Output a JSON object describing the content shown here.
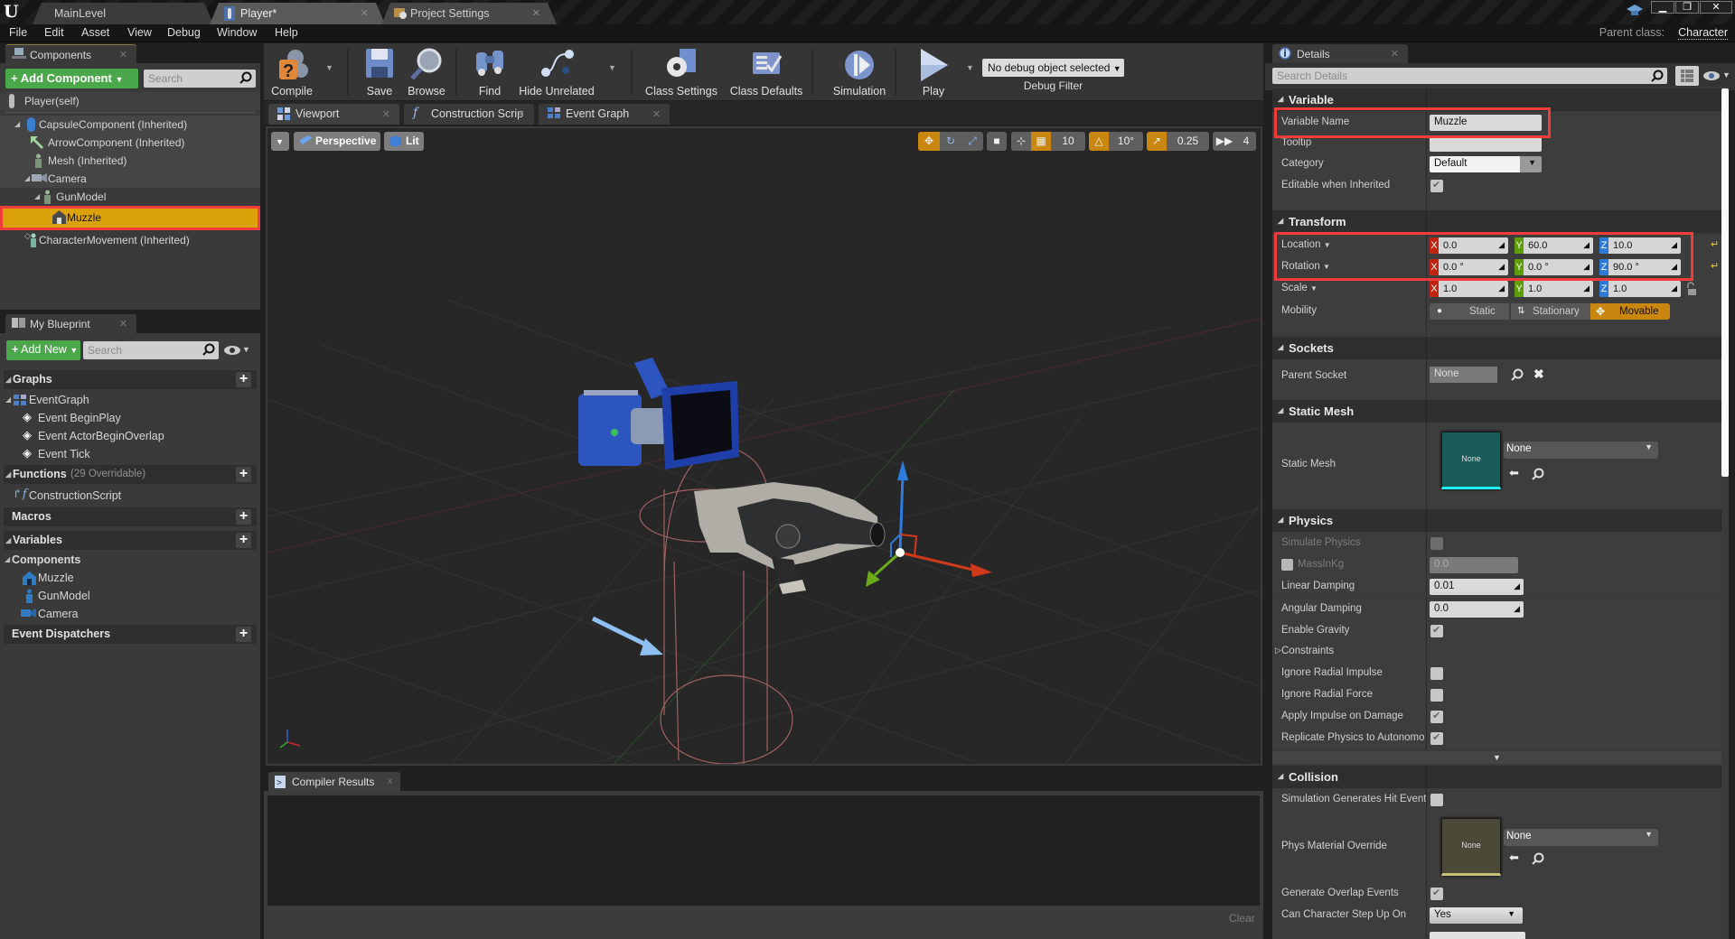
{
  "window": {
    "tabs": [
      {
        "label": "MainLevel"
      },
      {
        "label": "Player*"
      },
      {
        "label": "Project Settings"
      }
    ],
    "parent_class_label": "Parent class:",
    "parent_class_value": "Character"
  },
  "menu": [
    "File",
    "Edit",
    "Asset",
    "View",
    "Debug",
    "Window",
    "Help"
  ],
  "components": {
    "tab_label": "Components",
    "add_button": "Add Component",
    "search_placeholder": "Search",
    "root": "Player(self)",
    "tree": [
      {
        "label": "CapsuleComponent (Inherited)",
        "icon": "capsule-icon"
      },
      {
        "label": "ArrowComponent (Inherited)",
        "icon": "arrow-component-icon"
      },
      {
        "label": "Mesh (Inherited)",
        "icon": "skeletal-mesh-icon"
      },
      {
        "label": "Camera",
        "icon": "camera-icon"
      },
      {
        "label": "GunModel",
        "icon": "skeletal-mesh-icon"
      },
      {
        "label": "Muzzle",
        "icon": "scene-component-icon",
        "selected": true
      },
      {
        "label": "CharacterMovement (Inherited)",
        "icon": "movement-icon"
      }
    ]
  },
  "my_blueprint": {
    "tab_label": "My Blueprint",
    "add_button": "Add New",
    "search_placeholder": "Search",
    "graphs_header": "Graphs",
    "event_graph": "EventGraph",
    "events": [
      "Event BeginPlay",
      "Event ActorBeginOverlap",
      "Event Tick"
    ],
    "functions_header": "Functions",
    "functions_note": "(29 Overridable)",
    "functions": [
      "ConstructionScript"
    ],
    "macros_header": "Macros",
    "variables_header": "Variables",
    "components_subheader": "Components",
    "component_vars": [
      "Muzzle",
      "GunModel",
      "Camera"
    ],
    "dispatchers_header": "Event Dispatchers"
  },
  "toolbar": {
    "compile": "Compile",
    "save": "Save",
    "browse": "Browse",
    "find": "Find",
    "hide_unrelated": "Hide Unrelated",
    "class_settings": "Class Settings",
    "class_defaults": "Class Defaults",
    "simulation": "Simulation",
    "play": "Play",
    "debug_selected": "No debug object selected",
    "debug_filter_label": "Debug Filter"
  },
  "editor_tabs": [
    {
      "label": "Viewport",
      "active": true
    },
    {
      "label": "Construction Scrip"
    },
    {
      "label": "Event Graph"
    }
  ],
  "viewport": {
    "view_mode": "Perspective",
    "lighting": "Lit",
    "grid_snap": "10",
    "rotation_snap": "10°",
    "scale_snap": "0.25",
    "camera_speed": "4"
  },
  "compiler_results": {
    "tab_label": "Compiler Results",
    "clear_label": "Clear"
  },
  "details": {
    "tab_label": "Details",
    "search_placeholder": "Search Details",
    "variable": {
      "header": "Variable",
      "name_label": "Variable Name",
      "name_value": "Muzzle",
      "tooltip_label": "Tooltip",
      "tooltip_value": "",
      "category_label": "Category",
      "category_value": "Default",
      "editable_label": "Editable when Inherited",
      "editable_checked": true
    },
    "transform": {
      "header": "Transform",
      "axis_labels": [
        "X",
        "Y",
        "Z"
      ],
      "location": {
        "label": "Location",
        "x": "0.0",
        "y": "60.0",
        "z": "10.0"
      },
      "rotation": {
        "label": "Rotation",
        "x": "0.0 °",
        "y": "0.0 °",
        "z": "90.0 °"
      },
      "scale": {
        "label": "Scale",
        "x": "1.0",
        "y": "1.0",
        "z": "1.0"
      },
      "mobility": {
        "label": "Mobility",
        "options": [
          "Static",
          "Stationary",
          "Movable"
        ],
        "selected": "Movable"
      }
    },
    "sockets": {
      "header": "Sockets",
      "parent_socket_label": "Parent Socket",
      "parent_socket_value": "None"
    },
    "static_mesh": {
      "header": "Static Mesh",
      "label": "Static Mesh",
      "thumbnail_text": "None",
      "value": "None"
    },
    "physics": {
      "header": "Physics",
      "simulate_physics_label": "Simulate Physics",
      "simulate_physics": false,
      "mass_label": "MassInKg",
      "mass_value": "0.0",
      "linear_damping_label": "Linear Damping",
      "linear_damping": "0.01",
      "angular_damping_label": "Angular Damping",
      "angular_damping": "0.0",
      "enable_gravity_label": "Enable Gravity",
      "enable_gravity": true,
      "constraints_label": "Constraints",
      "ignore_radial_impulse_label": "Ignore Radial Impulse",
      "ignore_radial_impulse": false,
      "ignore_radial_force_label": "Ignore Radial Force",
      "ignore_radial_force": false,
      "apply_impulse_label": "Apply Impulse on Damage",
      "apply_impulse": true,
      "replicate_label": "Replicate Physics to Autonomo",
      "replicate": true
    },
    "collision": {
      "header": "Collision",
      "sim_hit_label": "Simulation Generates Hit Event",
      "sim_hit": false,
      "phys_material_label": "Phys Material Override",
      "phys_material_thumb": "None",
      "phys_material_value": "None",
      "overlap_label": "Generate Overlap Events",
      "overlap": true,
      "step_up_label": "Can Character Step Up On",
      "step_up_value": "Yes"
    }
  },
  "colors": {
    "selection": "#dca20a",
    "highlight_box": "#f23c3c",
    "add_button": "#4aa84a",
    "axis_x": "#c1220d",
    "axis_y": "#5e9c08",
    "axis_z": "#2d79d6",
    "movable": "#c9870f"
  }
}
